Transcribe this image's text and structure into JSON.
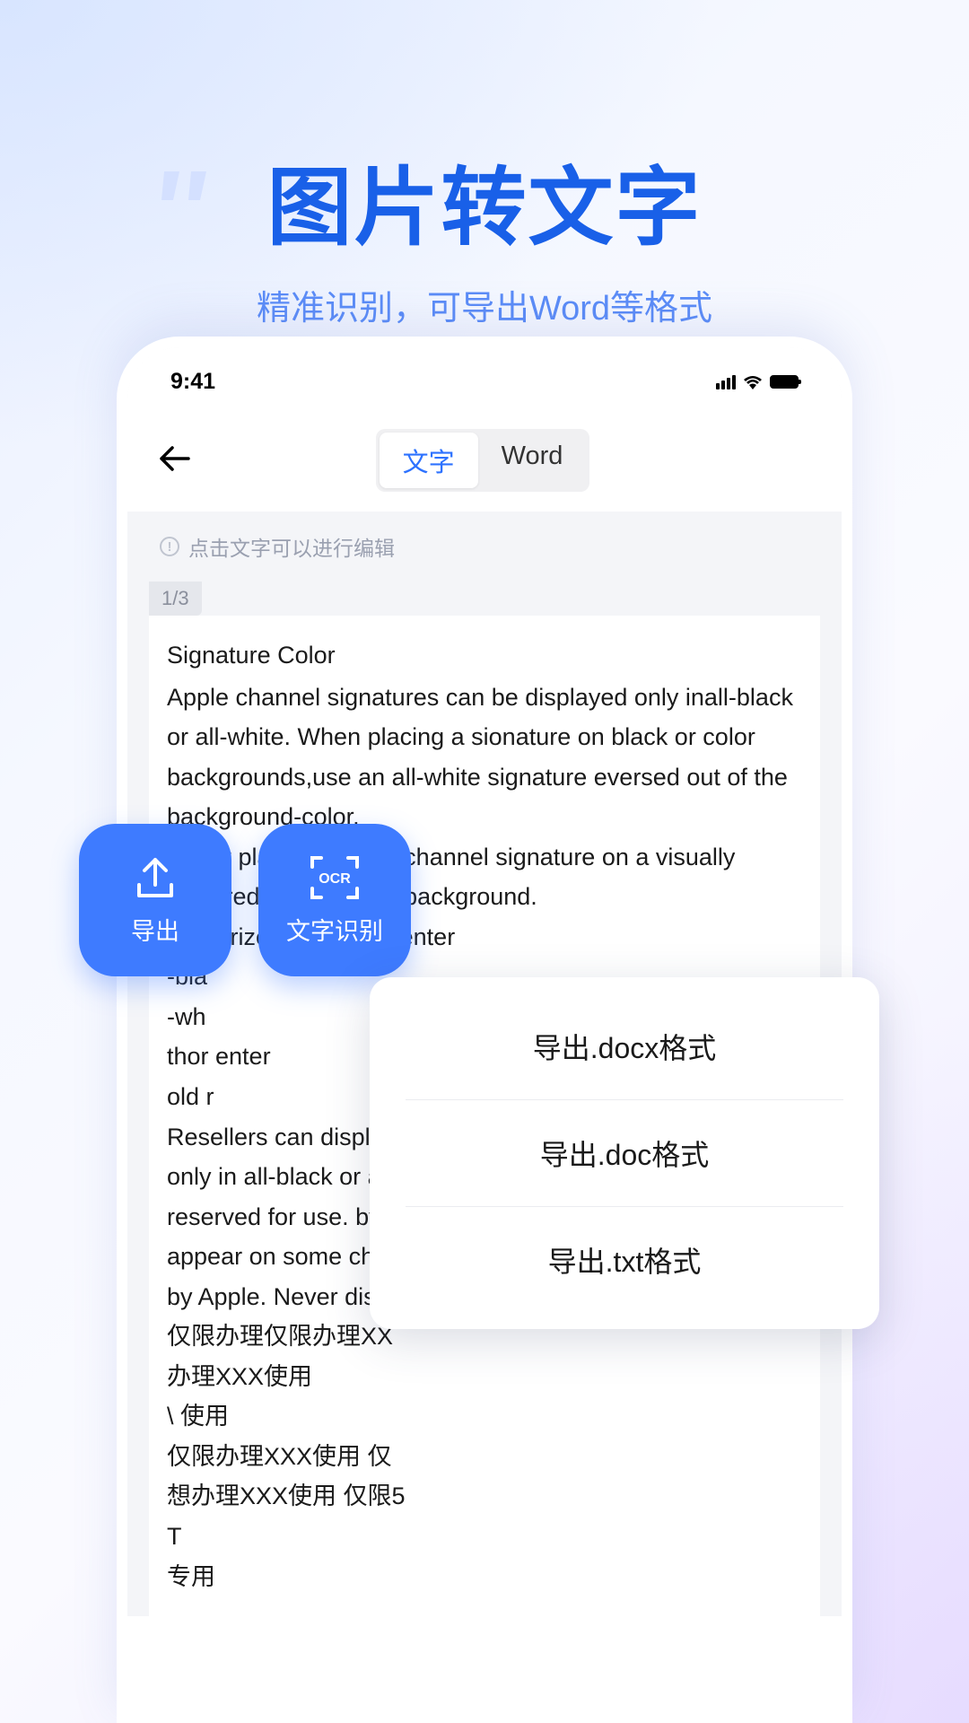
{
  "header": {
    "title": "图片转文字",
    "subtitle": "精准识别，可导出Word等格式"
  },
  "statusBar": {
    "time": "9:41"
  },
  "nav": {
    "tabs": [
      "文字",
      "Word"
    ],
    "activeTab": 0
  },
  "tip": "点击文字可以进行编辑",
  "document": {
    "pageIndicator": "1/3",
    "title": "Signature Color",
    "body": "Apple channel signatures can be displayed only inall-black or all-white. When placing a sionature on black or color backgrounds,use an all-white signature eversed out of the background-color.\nNever place an Apple channel signature on a visually cluttered or patterned background.\nAuthorized Training Center\n-bla\n-wh\nthor                      enter\nold r\nResellers can display their Apple-provided authorization only in all-black or all-white. An Apple l\nreserved for use. by\nappear on some cha\nby Apple. Never disp\n仅限办理仅限办理XX\n办理XXX使用\n\\ 使用\n仅限办理XXX使用 仅\n想办理XXX使用 仅限5\nT\n专用"
  },
  "actions": {
    "export": "导出",
    "ocr": "文字识别",
    "ocrBadge": "OCR"
  },
  "exportMenu": [
    "导出.docx格式",
    "导出.doc格式",
    "导出.txt格式"
  ]
}
